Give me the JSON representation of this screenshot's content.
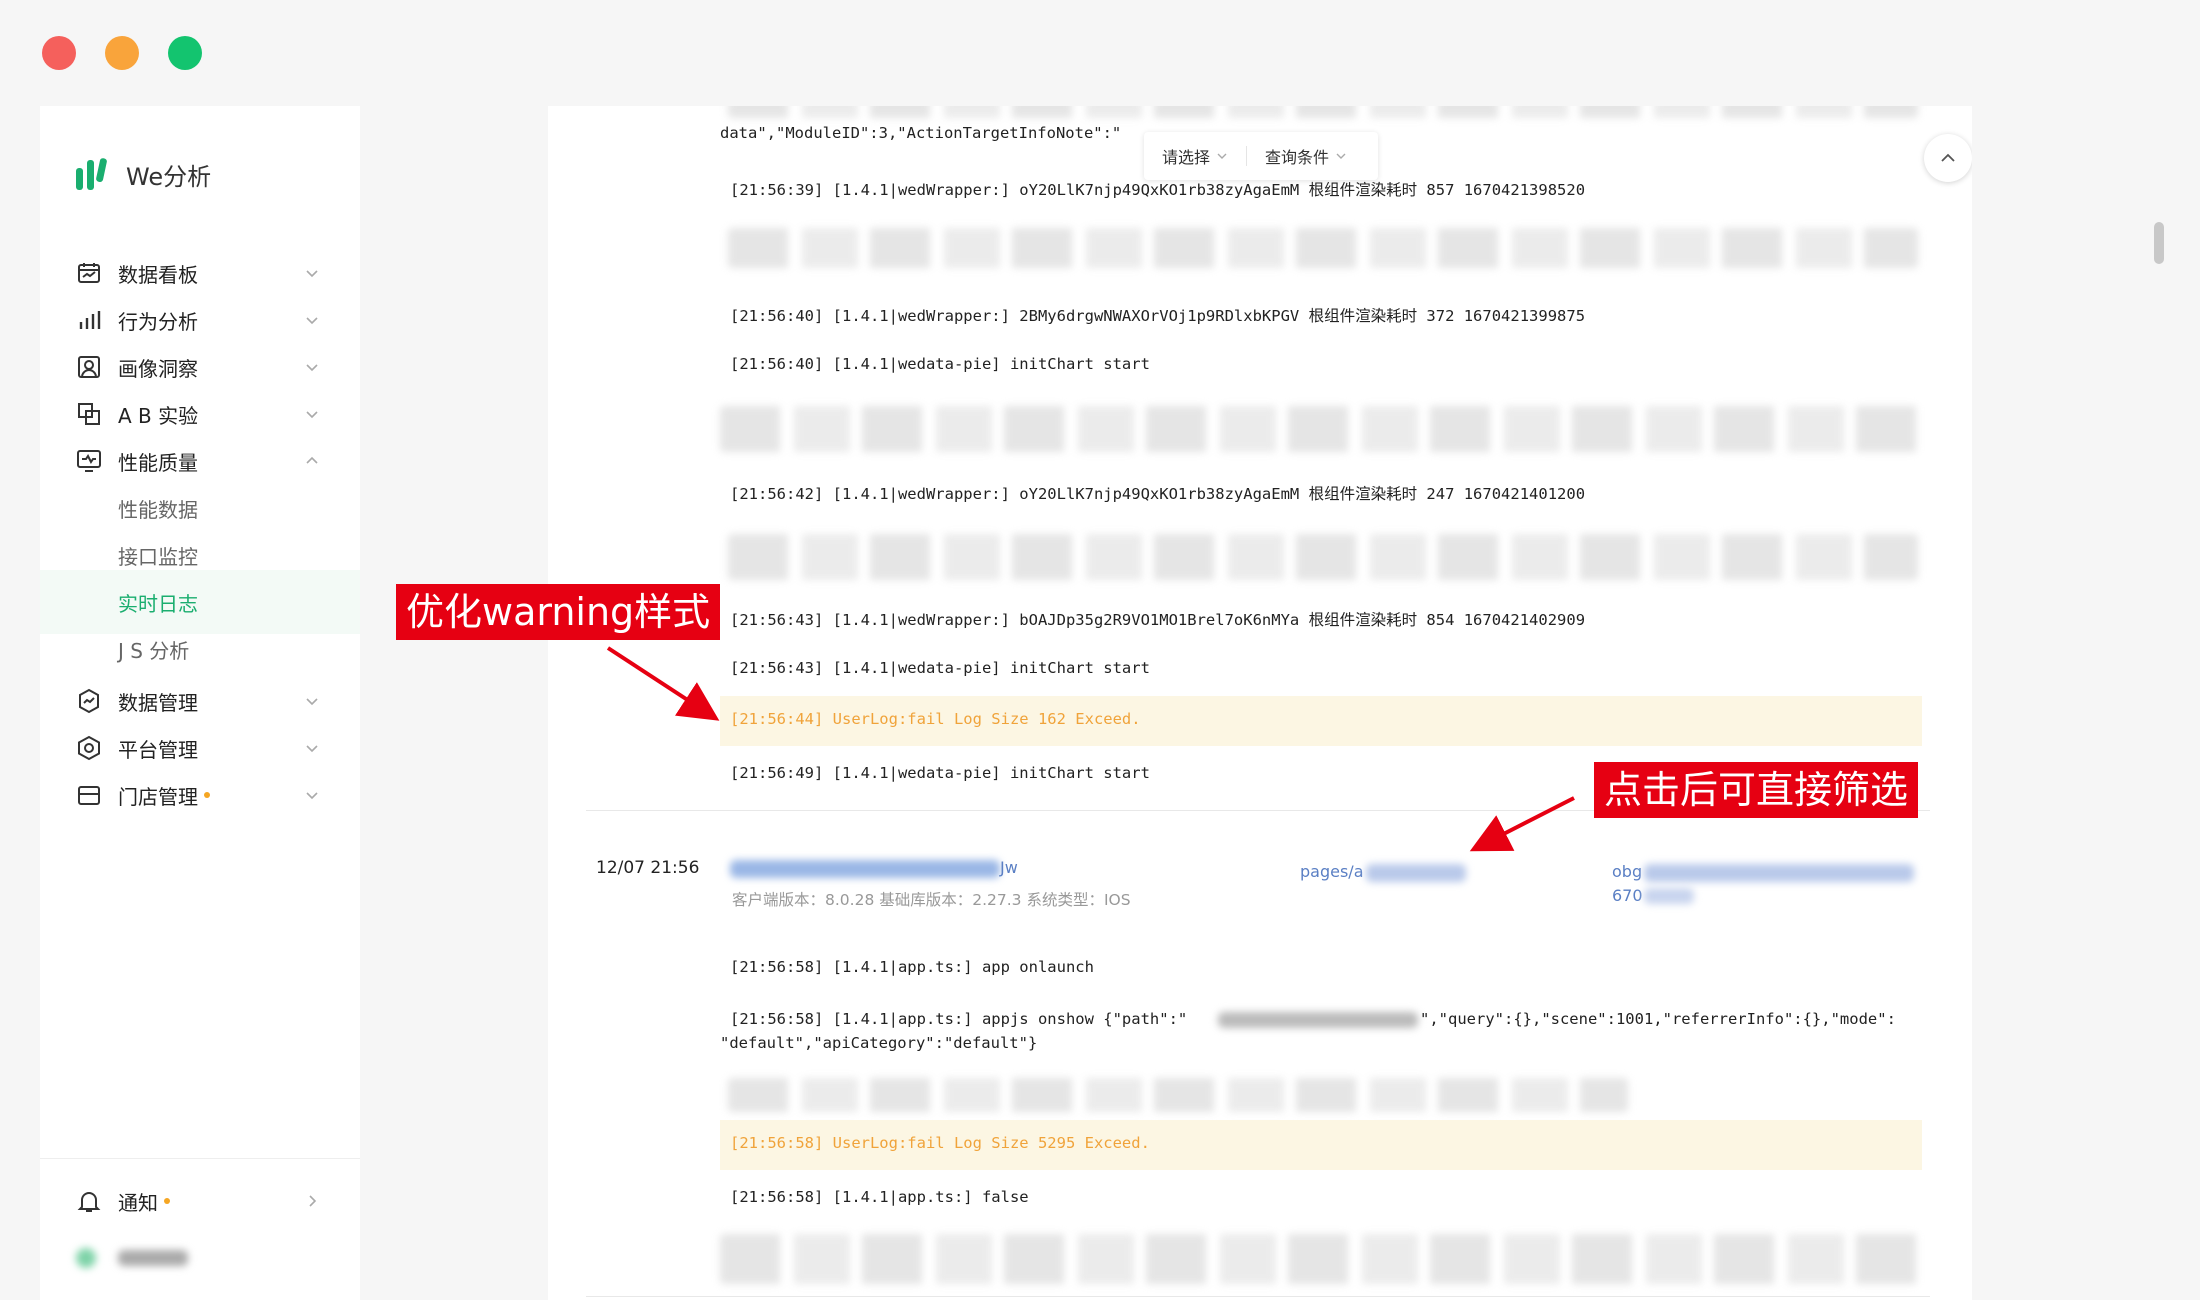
{
  "window": {
    "colors": {
      "close": "#f5605c",
      "minimize": "#f9a43b",
      "maximize": "#13c46f"
    }
  },
  "app": {
    "title": "We分析",
    "accent": "#1aae6f"
  },
  "sidebar": {
    "items": [
      {
        "label": "数据看板"
      },
      {
        "label": "行为分析"
      },
      {
        "label": "画像洞察"
      },
      {
        "label": "A B 实验"
      },
      {
        "label": "性能质量"
      },
      {
        "label": "数据管理"
      },
      {
        "label": "平台管理"
      },
      {
        "label": "门店管理"
      }
    ],
    "subitems": [
      {
        "label": "性能数据"
      },
      {
        "label": "接口监控"
      },
      {
        "label": "实时日志"
      },
      {
        "label": "J S  分析"
      }
    ],
    "notify": {
      "label": "通知"
    }
  },
  "filters": {
    "select": "请选择",
    "condition": "查询条件"
  },
  "logs": {
    "top_data": "data\",\"ModuleID\":3,\"ActionTargetInfoNote\":\"",
    "l1": "[21:56:39] [1.4.1|wedWrapper:] oY20LlK7njp49QxKO1rb38zyAgaEmM 根组件渲染耗时 857 1670421398520",
    "l2": "[21:56:40] [1.4.1|wedWrapper:] 2BMy6drgwNWAXOrVOj1p9RDlxbKPGV 根组件渲染耗时 372 1670421399875",
    "l3": "[21:56:40] [1.4.1|wedata-pie] initChart start",
    "l4": "[21:56:42] [1.4.1|wedWrapper:] oY20LlK7njp49QxKO1rb38zyAgaEmM 根组件渲染耗时 247 1670421401200",
    "l5": "[21:56:43] [1.4.1|wedWrapper:] bOAJDp35g2R9VO1MO1Brel7oK6nMYa 根组件渲染耗时 854 1670421402909",
    "l6": "[21:56:43] [1.4.1|wedata-pie] initChart start",
    "w1": "[21:56:44] UserLog:fail Log Size 162 Exceed.",
    "l7": "[21:56:49] [1.4.1|wedata-pie] initChart start",
    "e2_l1": "[21:56:58] [1.4.1|app.ts:] app onlaunch",
    "e2_l2a": "[21:56:58] [1.4.1|app.ts:] appjs onshow {\"path\":\"",
    "e2_l2b": "\",\"query\":{},\"scene\":1001,\"referrerInfo\":{},\"mode\":",
    "e2_l2c": "\"default\",\"apiCategory\":\"default\"}",
    "w2": "[21:56:58] UserLog:fail Log Size 5295 Exceed.",
    "e2_l3": "[21:56:58] [1.4.1|app.ts:] false"
  },
  "entry": {
    "time": "12/07 21:56",
    "user_suffix": "Jw",
    "meta": "客户端版本：8.0.28 基础库版本：2.27.3 系统类型：IOS",
    "page": "pages/a",
    "obg": "obg",
    "num": "670"
  },
  "annotations": {
    "warning": "优化warning样式",
    "filter": "点击后可直接筛选",
    "color": "#e60012"
  }
}
